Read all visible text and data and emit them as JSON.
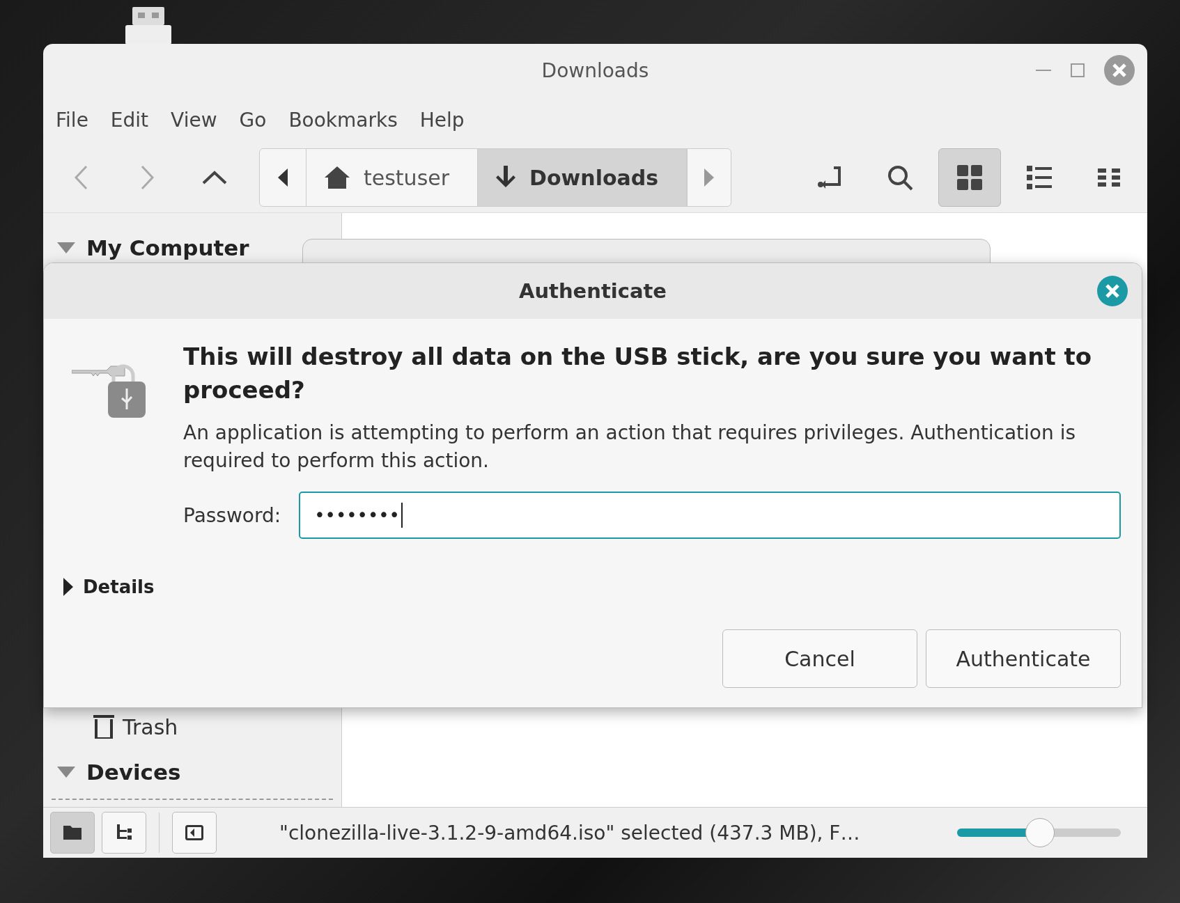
{
  "window": {
    "title": "Downloads"
  },
  "menu": [
    {
      "label": "File"
    },
    {
      "label": "Edit"
    },
    {
      "label": "View"
    },
    {
      "label": "Go"
    },
    {
      "label": "Bookmarks"
    },
    {
      "label": "Help"
    }
  ],
  "toolbar": {
    "breadcrumbs": [
      {
        "label": "testuser",
        "kind": "home",
        "selected": false
      },
      {
        "label": "Downloads",
        "kind": "downloads",
        "selected": true
      }
    ],
    "views": [
      {
        "kind": "icons",
        "selected": true
      },
      {
        "kind": "list",
        "selected": false
      },
      {
        "kind": "compact",
        "selected": false
      }
    ]
  },
  "sidebar": {
    "sections": [
      {
        "label": "My Computer",
        "expanded": true,
        "items": [
          {
            "label": "Trash"
          }
        ]
      },
      {
        "label": "Devices",
        "expanded": true
      }
    ]
  },
  "dialog": {
    "title": "Authenticate",
    "heading": "This will destroy all data on the USB stick, are you sure you want to proceed?",
    "message": "An application is attempting to perform an action that requires privileges. Authentication is required to perform this action.",
    "password_label": "Password:",
    "password_value": "••••••••",
    "details": {
      "label": "Details",
      "expanded": false
    },
    "buttons": [
      "Cancel",
      "Authenticate"
    ]
  },
  "status_bar": {
    "panes": [
      {
        "kind": "places",
        "selected": true
      },
      {
        "kind": "tree",
        "selected": false
      },
      {
        "kind": "sidebar",
        "selected": false
      }
    ],
    "text": "\"clonezilla-live-3.1.2-9-amd64.iso\" selected (437.3 MB), F…",
    "zoom": {
      "level": 0.5
    }
  }
}
